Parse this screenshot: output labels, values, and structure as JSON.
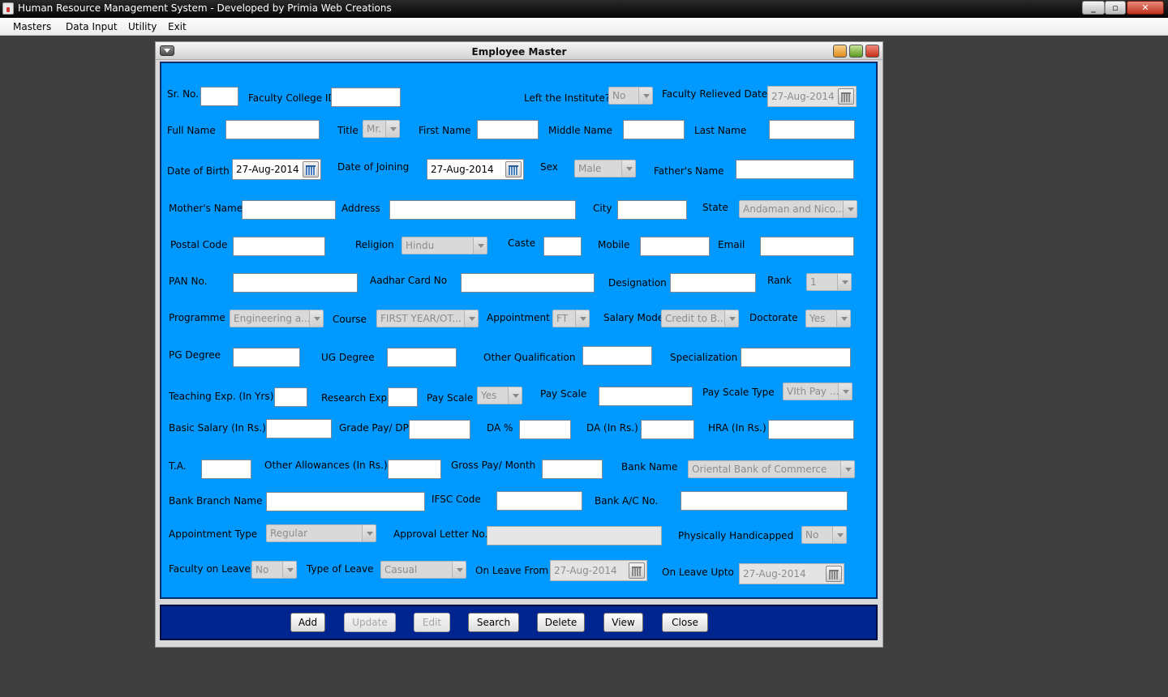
{
  "window": {
    "title": "Human Resource Management System - Developed by Primia Web Creations",
    "minimize_glyph": "_",
    "restore_glyph": "▫",
    "close_glyph": "✕"
  },
  "menu": [
    "Masters",
    "Data Input",
    "Utility",
    "Exit"
  ],
  "frame": {
    "title": "Employee Master"
  },
  "labels": {
    "sr_no": "Sr. No.",
    "faculty_college_id": "Faculty College ID",
    "left_institute": "Left the Institute?",
    "faculty_relieved_date": "Faculty Relieved Date",
    "full_name": "Full Name",
    "title": "Title",
    "first_name": "First Name",
    "middle_name": "Middle Name",
    "last_name": "Last Name",
    "dob": "Date of Birth",
    "doj": "Date of Joining",
    "sex": "Sex",
    "fathers_name": "Father's Name",
    "mothers_name": "Mother's Name",
    "address": "Address",
    "city": "City",
    "state": "State",
    "postal_code": "Postal Code",
    "religion": "Religion",
    "caste": "Caste",
    "mobile": "Mobile",
    "email": "Email",
    "pan_no": "PAN No.",
    "aadhar": "Aadhar Card No",
    "designation": "Designation",
    "rank": "Rank",
    "programme": "Programme",
    "course": "Course",
    "appointment": "Appointment",
    "salary_mode": "Salary Mode",
    "doctorate": "Doctorate",
    "pg_degree": "PG Degree",
    "ug_degree": "UG Degree",
    "other_qualification": "Other Qualification",
    "specialization": "Specialization",
    "teaching_exp": "Teaching Exp. (In Yrs)",
    "research_exp": "Research Exp.",
    "pay_scale_1": "Pay Scale",
    "pay_scale_2": "Pay Scale",
    "pay_scale_type": "Pay Scale Type",
    "basic_salary": "Basic Salary (In Rs.)",
    "grade_pay": "Grade Pay/ DP",
    "da_pct": "DA %",
    "da_rs": "DA (In Rs.)",
    "hra": "HRA (In Rs.)",
    "ta": "T.A.",
    "other_allowances": "Other Allowances (In Rs.)",
    "gross_pay": "Gross Pay/ Month",
    "bank_name": "Bank Name",
    "bank_branch": "Bank Branch Name",
    "ifsc": "IFSC Code",
    "bank_ac": "Bank A/C No.",
    "appointment_type": "Appointment Type",
    "approval_letter": "Approval Letter No.",
    "physically_handicapped": "Physically Handicapped",
    "faculty_on_leave": "Faculty on Leave",
    "type_of_leave": "Type of Leave",
    "on_leave_from": "On Leave From",
    "on_leave_upto": "On Leave Upto"
  },
  "values": {
    "left_institute": "No",
    "faculty_relieved_date": "27-Aug-2014",
    "title": "Mr.",
    "dob": "27-Aug-2014",
    "doj": "27-Aug-2014",
    "sex": "Male",
    "state": "Andaman and Nico...",
    "religion": "Hindu",
    "rank": "1",
    "programme": "Engineering a...",
    "course": "FIRST YEAR/OT...",
    "appointment": "FT",
    "salary_mode": "Credit to B...",
    "doctorate": "Yes",
    "pay_scale_1": "Yes",
    "pay_scale_type": "VIth Pay ...",
    "bank_name": "Oriental Bank of Commerce",
    "appointment_type": "Regular",
    "physically_handicapped": "No",
    "faculty_on_leave": "No",
    "type_of_leave": "Casual",
    "on_leave_from": "27-Aug-2014",
    "on_leave_upto": "27-Aug-2014"
  },
  "buttons": {
    "add": "Add",
    "update": "Update",
    "edit": "Edit",
    "search": "Search",
    "delete": "Delete",
    "view": "View",
    "close": "Close"
  },
  "colors": {
    "form_background": "#0099ff",
    "button_panel_background": "#00258e",
    "desktop_background": "#3f3f3f"
  }
}
